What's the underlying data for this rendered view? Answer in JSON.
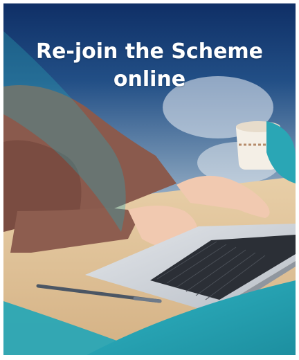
{
  "banner": {
    "headline_line1": "Re-join the Scheme",
    "headline_line2": "online"
  },
  "colors": {
    "navy": "#143c73",
    "teal": "#2aa6b5",
    "teal_light": "#3cbfcf",
    "skin": "#f1c9b0",
    "sleeve": "#8a5a4d",
    "laptop": "#cfd3d8"
  },
  "icons": [
    "laptop-illustration",
    "pen-illustration",
    "mug-illustration"
  ]
}
